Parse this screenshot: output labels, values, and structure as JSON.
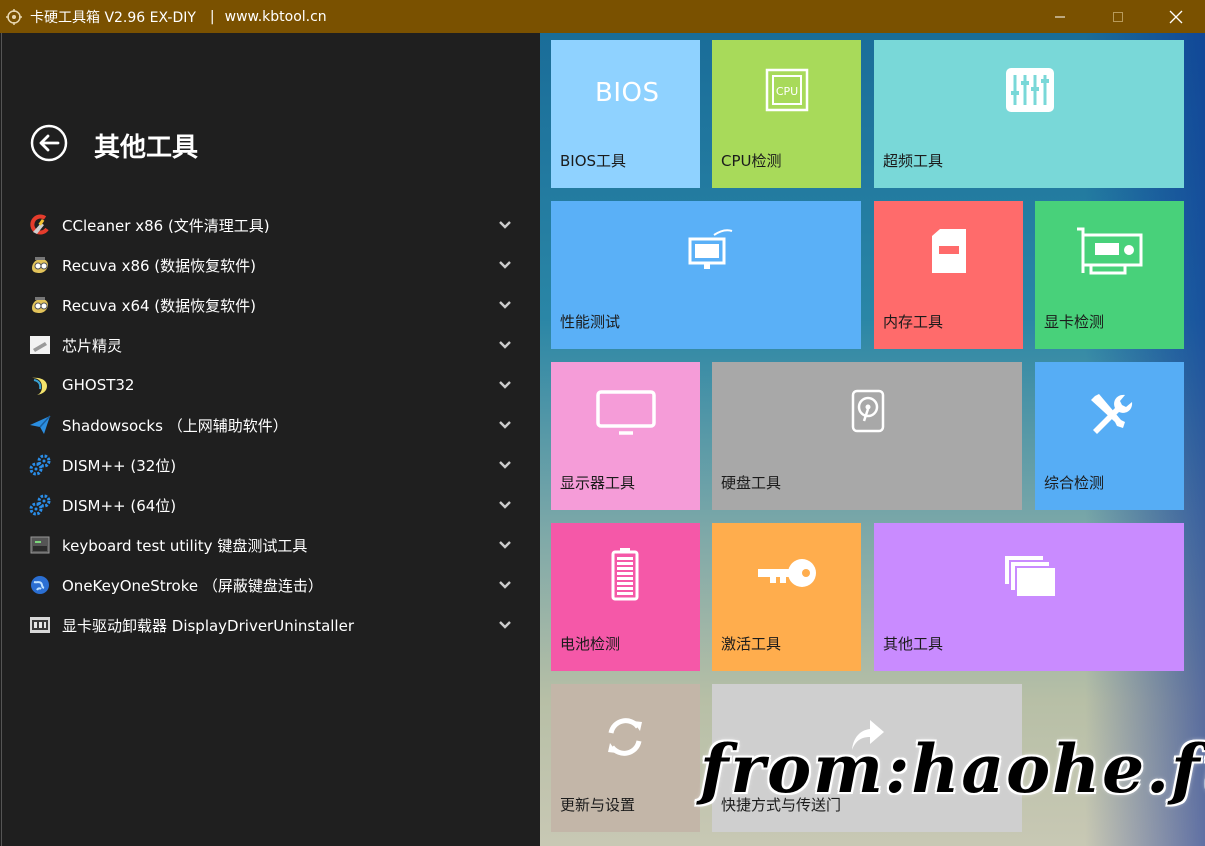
{
  "titlebar": {
    "app_title": "卡硬工具箱 V2.96  EX-DIY",
    "separator": "|",
    "url": "www.kbtool.cn"
  },
  "page": {
    "title": "其他工具"
  },
  "tools": [
    {
      "label": "CCleaner x86 (文件清理工具)",
      "icon": "ccleaner-icon"
    },
    {
      "label": "Recuva x86 (数据恢复软件)",
      "icon": "recuva-icon"
    },
    {
      "label": "Recuva x64 (数据恢复软件)",
      "icon": "recuva-icon"
    },
    {
      "label": "芯片精灵",
      "icon": "chip-icon"
    },
    {
      "label": "GHOST32",
      "icon": "ghost-icon"
    },
    {
      "label": "Shadowsocks （上网辅助软件）",
      "icon": "paper-plane-icon"
    },
    {
      "label": "DISM++ (32位)",
      "icon": "gears-icon"
    },
    {
      "label": "DISM++ (64位)",
      "icon": "gears-icon"
    },
    {
      "label": "keyboard test utility 键盘测试工具",
      "icon": "keyboard-icon"
    },
    {
      "label": "OneKeyOneStroke （屏蔽键盘连击）",
      "icon": "globe-icon"
    },
    {
      "label": "显卡驱动卸载器 DisplayDriverUninstaller",
      "icon": "ddu-icon"
    }
  ],
  "tiles": {
    "bios": {
      "label": "BIOS工具",
      "icon_text": "BIOS"
    },
    "cpu": {
      "label": "CPU检测",
      "icon_text": "CPU"
    },
    "overclock": {
      "label": "超频工具"
    },
    "performance": {
      "label": "性能测试"
    },
    "memory": {
      "label": "内存工具"
    },
    "gpu": {
      "label": "显卡检测"
    },
    "monitor": {
      "label": "显示器工具"
    },
    "disk": {
      "label": "硬盘工具"
    },
    "diagnostics": {
      "label": "综合检测"
    },
    "battery": {
      "label": "电池检测"
    },
    "activation": {
      "label": "激活工具"
    },
    "other": {
      "label": "其他工具"
    },
    "update": {
      "label": "更新与设置"
    },
    "shortcut": {
      "label": "快捷方式与传送门"
    }
  },
  "watermark": "from:haohe.fun"
}
